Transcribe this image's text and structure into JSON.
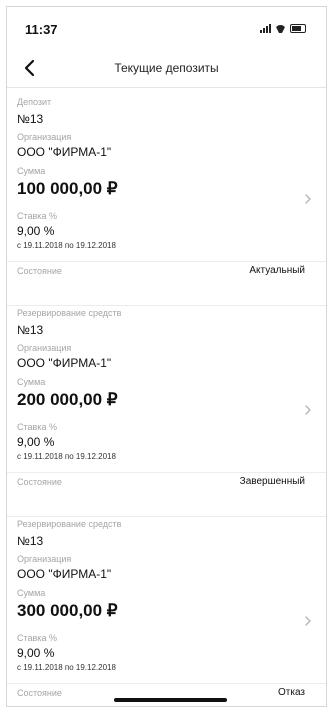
{
  "status_bar": {
    "time": "11:37"
  },
  "nav": {
    "title": "Текущие депозиты"
  },
  "labels": {
    "organization": "Организация",
    "amount": "Сумма",
    "rate": "Ставка %",
    "state": "Состояние"
  },
  "deposits": [
    {
      "type": "Депозит",
      "number": "№13",
      "organization": "ООО \"ФИРМА-1\"",
      "amount": "100 000,00 ₽",
      "rate": "9,00 %",
      "period": "с 19.11.2018 по 19.12.2018",
      "state": "Актуальный"
    },
    {
      "type": "Резервирование средств",
      "number": "№13",
      "organization": "ООО \"ФИРМА-1\"",
      "amount": "200 000,00 ₽",
      "rate": "9,00 %",
      "period": "с 19.11.2018 по 19.12.2018",
      "state": "Завершенный"
    },
    {
      "type": "Резервирование средств",
      "number": "№13",
      "organization": "ООО \"ФИРМА-1\"",
      "amount": "300 000,00 ₽",
      "rate": "9,00 %",
      "period": "с 19.11.2018 по 19.12.2018",
      "state": "Отказ"
    }
  ],
  "icons": {
    "back": "chevron-left-icon",
    "row": "chevron-right-icon",
    "signal": "signal-icon",
    "wifi": "wifi-icon",
    "battery": "battery-icon"
  }
}
